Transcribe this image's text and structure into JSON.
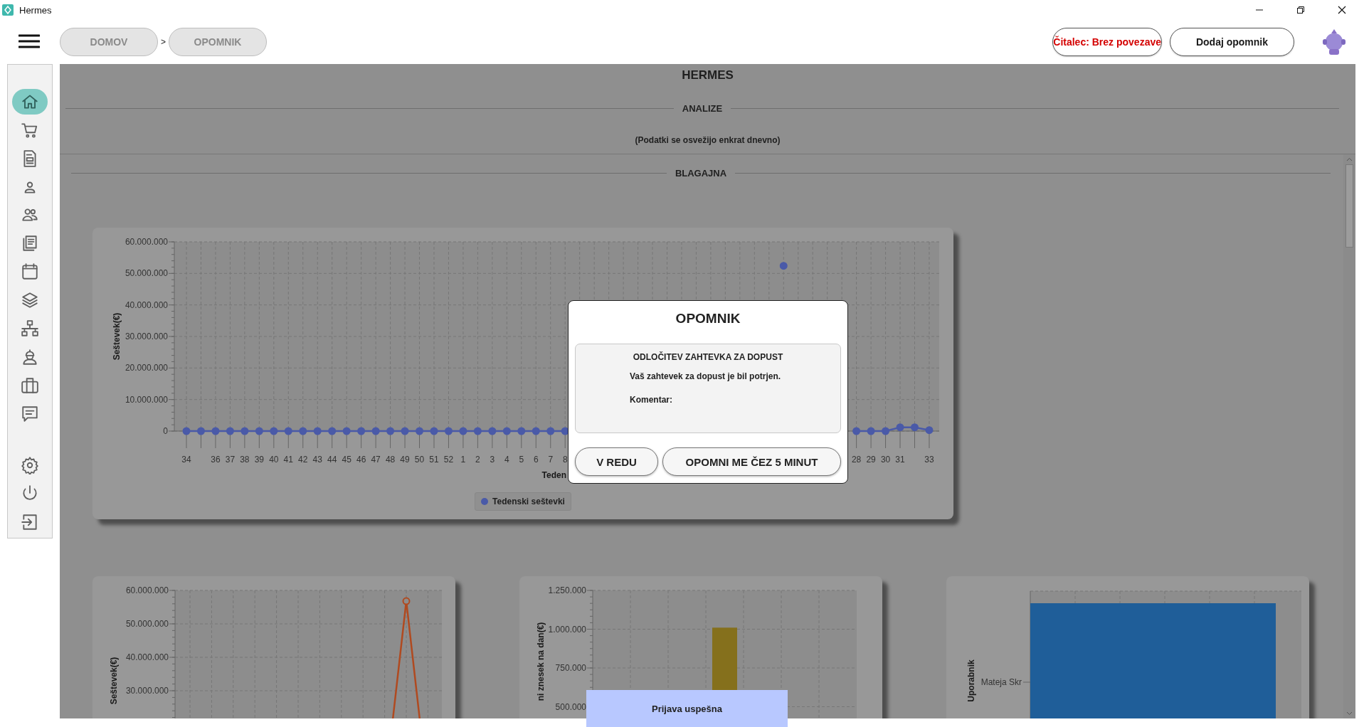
{
  "window": {
    "title": "Hermes"
  },
  "header": {
    "breadcrumbs": [
      {
        "label": "DOMOV"
      },
      {
        "label": "OPOMNIK"
      }
    ],
    "separator": ">",
    "buttons": [
      {
        "label": "Čitalec: Brez povezave",
        "kind": "status"
      },
      {
        "label": "Dodaj opomnik",
        "kind": "action"
      }
    ]
  },
  "sidebar": {
    "items": [
      {
        "kind": "home",
        "selected": true
      },
      {
        "kind": "cart",
        "selected": false
      },
      {
        "kind": "document",
        "selected": false
      },
      {
        "kind": "person",
        "selected": false
      },
      {
        "kind": "people",
        "selected": false
      },
      {
        "kind": "documents",
        "selected": false
      },
      {
        "kind": "calendar",
        "selected": false
      },
      {
        "kind": "layers",
        "selected": false
      },
      {
        "kind": "network",
        "selected": false
      },
      {
        "kind": "worker",
        "selected": false
      },
      {
        "kind": "briefcase",
        "selected": false
      },
      {
        "kind": "chat",
        "selected": false
      }
    ],
    "footer_items": [
      {
        "kind": "gear",
        "selected": false
      },
      {
        "kind": "power",
        "selected": false
      },
      {
        "kind": "logout",
        "selected": false
      }
    ]
  },
  "page": {
    "title": "HERMES",
    "section": "ANALIZE",
    "note": "(Podatki se osvežijo enkrat dnevno)",
    "subsection": "BLAGAJNA"
  },
  "weekly_chart": {
    "chart_data": {
      "type": "line",
      "xlabel": "Teden",
      "ylabel": "Seštevek(€)",
      "grid": true,
      "categories": [
        "34",
        null,
        "36",
        "37",
        "38",
        "39",
        "40",
        "41",
        "42",
        "43",
        "44",
        "45",
        "46",
        "47",
        "48",
        "49",
        "50",
        "51",
        "52",
        "1",
        "2",
        "3",
        "4",
        "5",
        "6",
        "7",
        "8",
        null,
        null,
        null,
        null,
        null,
        null,
        null,
        null,
        null,
        null,
        null,
        null,
        null,
        null,
        null,
        null,
        null,
        null,
        null,
        "28",
        "29",
        "30",
        "31",
        null,
        "33"
      ],
      "series": [
        {
          "name": "Tedenski seštevki",
          "color": "#4a5aa8",
          "marker": "circle",
          "values": [
            0,
            0,
            0,
            0,
            0,
            0,
            0,
            0,
            0,
            0,
            0,
            0,
            0,
            0,
            0,
            0,
            0,
            0,
            0,
            0,
            0,
            0,
            0,
            0,
            0,
            0,
            0,
            null,
            null,
            null,
            null,
            null,
            null,
            null,
            null,
            null,
            null,
            null,
            null,
            null,
            null,
            52400000,
            null,
            null,
            null,
            null,
            0,
            0,
            0,
            1200000,
            1200000,
            300000
          ]
        }
      ],
      "ylim": [
        0,
        60000000
      ],
      "yticks": [
        {
          "value": 0,
          "label": "0"
        },
        {
          "value": 10000000,
          "label": "10.000.000"
        },
        {
          "value": 20000000,
          "label": "20.000.000"
        },
        {
          "value": 30000000,
          "label": "30.000.000"
        },
        {
          "value": 40000000,
          "label": "40.000.000"
        },
        {
          "value": 50000000,
          "label": "50.000.000"
        },
        {
          "value": 60000000,
          "label": "60.000.000"
        }
      ]
    }
  },
  "charts_row": [
    {
      "chart_data": {
        "type": "line",
        "ylabel": "Seštevek(€)",
        "grid": true,
        "series": [
          {
            "color": "#b04a20",
            "marker": "circle",
            "values": [
              null,
              null,
              null,
              null,
              null,
              null,
              null,
              null,
              null,
              0,
              56800000,
              0
            ]
          }
        ],
        "ylim": [
          0,
          60000000
        ],
        "yticks": [
          {
            "value": 30000000,
            "label": "30.000.000"
          },
          {
            "value": 40000000,
            "label": "40.000.000"
          },
          {
            "value": 50000000,
            "label": "50.000.000"
          },
          {
            "value": 60000000,
            "label": "60.000.000"
          }
        ]
      }
    },
    {
      "chart_data": {
        "type": "bar",
        "ylabel": "ni znesek na dan(€)",
        "grid": true,
        "series": [
          {
            "color": "#85701c",
            "values": [
              null,
              null,
              null,
              1010000,
              null,
              null,
              null
            ]
          }
        ],
        "ylim": [
          0,
          1250000
        ],
        "yticks": [
          {
            "value": 500000,
            "label": "500.000"
          },
          {
            "value": 750000,
            "label": "750.000"
          },
          {
            "value": 1000000,
            "label": "1.000.000"
          },
          {
            "value": 1250000,
            "label": "1.250.000"
          }
        ]
      }
    },
    {
      "ylabel": "Uporabnik",
      "category": "Mateja Skr"
    }
  ],
  "dialog": {
    "title": "OPOMNIK",
    "heading": "ODLOČITEV ZAHTEVKA ZA DOPUST",
    "message": "Vaš zahtevek za dopust je bil potrjen.",
    "comment_label": "Komentar:",
    "buttons": [
      {
        "label": "V REDU"
      },
      {
        "label": "OPOMNI ME ČEZ 5 MINUT"
      }
    ]
  },
  "toast": {
    "text": "Prijava uspešna"
  }
}
